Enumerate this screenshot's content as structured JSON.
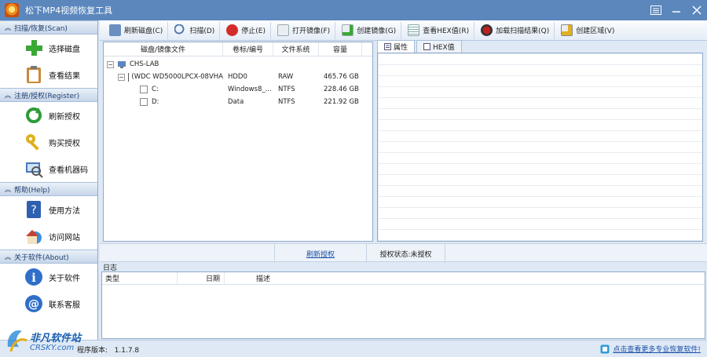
{
  "app": {
    "title": "松下MP4视频恢复工具"
  },
  "sidebar": {
    "groups": [
      {
        "header": "扫描/恢复(Scan)",
        "items": [
          {
            "label": "选择磁盘"
          },
          {
            "label": "查看结果"
          }
        ]
      },
      {
        "header": "注册/授权(Register)",
        "items": [
          {
            "label": "刷新授权"
          },
          {
            "label": "购买授权"
          },
          {
            "label": "查看机器码"
          }
        ]
      },
      {
        "header": "帮助(Help)",
        "items": [
          {
            "label": "使用方法"
          },
          {
            "label": "访问网站"
          }
        ]
      },
      {
        "header": "关于软件(About)",
        "items": [
          {
            "label": "关于软件"
          },
          {
            "label": "联系客服"
          }
        ]
      }
    ]
  },
  "toolbar": {
    "buttons": [
      {
        "label": "刷新磁盘(C)",
        "icon": "refresh-disk-icon"
      },
      {
        "label": "扫描(D)",
        "icon": "magnifier-icon"
      },
      {
        "label": "停止(E)",
        "icon": "stop-icon"
      },
      {
        "label": "打开镜像(F)",
        "icon": "open-image-icon"
      },
      {
        "label": "创建镜像(G)",
        "icon": "create-image-icon"
      },
      {
        "label": "查看HEX值(R)",
        "icon": "hex-icon"
      },
      {
        "label": "加载扫描结果(Q)",
        "icon": "load-result-icon"
      },
      {
        "label": "创建区域(V)",
        "icon": "create-region-icon"
      }
    ]
  },
  "disk_table": {
    "headers": [
      "磁盘/镜像文件",
      "卷标/编号",
      "文件系统",
      "容量"
    ],
    "root": "CHS-LAB",
    "rows": [
      {
        "name": "(WDC WD5000LPCX-08VHA",
        "label": "HDD0",
        "fs": "RAW",
        "size": "465.76 GB"
      },
      {
        "name": "C:",
        "label": "Windows8_...",
        "fs": "NTFS",
        "size": "228.46 GB"
      },
      {
        "name": "D:",
        "label": "Data",
        "fs": "NTFS",
        "size": "221.92 GB"
      }
    ]
  },
  "props": {
    "tabs": [
      "属性",
      "HEX值"
    ]
  },
  "status_strip": {
    "refresh": "刷新授权",
    "auth_status": "授权状态:未授权"
  },
  "log": {
    "title": "日志",
    "headers": [
      "类型",
      "日期",
      "描述"
    ]
  },
  "statusbar": {
    "version_label": "程序版本:",
    "version": "1.1.7.8",
    "promo": "点击查看更多专业恢复软件!",
    "watermark_title": "非凡软件站",
    "watermark_sub": "CRSKY.com"
  }
}
